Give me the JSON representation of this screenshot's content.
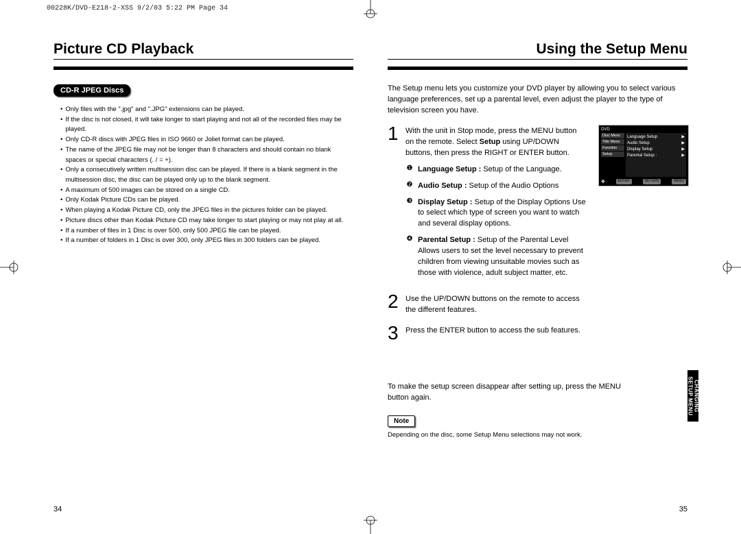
{
  "header": "00228K/DVD-E218-2-XSS  9/2/03 5:22 PM  Page 34",
  "left": {
    "title": "Picture CD Playback",
    "badge": "CD-R JPEG Discs",
    "bullets": [
      "Only files with the \".jpg\" and \".JPG\" extensions can be played.",
      "If the disc is not closed, it will take longer to start playing and not all of the recorded files may be played.",
      "Only CD-R discs with JPEG files in ISO 9660 or Joliet format can be played.",
      "The name of the JPEG file may not be longer than 8 characters and should contain no blank spaces or special characters (. / = +).",
      "Only a consecutively written multisession disc can be played. If there is a blank segment in the multisession disc, the disc can be played only up to the blank segment.",
      "A maximum of 500 images can be stored on a single CD.",
      "Only Kodak Picture CDs can be played.",
      "When playing a Kodak Picture CD, only the JPEG files in the pictures folder can be played.",
      "Picture discs other than Kodak Picture CD may take longer to start playing or may not play at all.",
      "If a number of files in 1 Disc is over 500, only 500 JPEG file can be played.",
      "If a number of folders in 1 Disc is over 300, only JPEG files in 300 folders can be played."
    ],
    "pagenum": "34"
  },
  "right": {
    "title": "Using the Setup Menu",
    "intro": "The Setup menu lets you customize your DVD player by allowing you to select various language preferences, set up a parental level, even adjust the player to the type of television screen you have.",
    "step1_lead": "With the unit in Stop mode, press the MENU button on the remote. Select ",
    "step1_bold": "Setup",
    "step1_tail": " using UP/DOWN buttons, then press the RIGHT or ENTER button.",
    "items": [
      {
        "mark": "❶",
        "label": "Language Setup :",
        "desc": "Setup of the Language."
      },
      {
        "mark": "❷",
        "label": "Audio Setup :",
        "desc": "Setup of the Audio Options"
      },
      {
        "mark": "❸",
        "label": "Display Setup :",
        "desc": "Setup of the Display Options Use to select which type of screen you want to watch and several display options."
      },
      {
        "mark": "❹",
        "label": "Parental Setup :",
        "desc": "Setup of the Parental Level Allows users to set the level necessary to prevent children from viewing unsuitable movies such as those with violence, adult subject matter, etc."
      }
    ],
    "step2": "Use the UP/DOWN buttons on the remote to access the different features.",
    "step3": "Press the ENTER button to access the sub features.",
    "footnote": "To make the setup screen disappear after setting up, press the MENU button again.",
    "note_label": "Note",
    "note_text": "Depending on the disc, some Setup Menu selections may not work.",
    "pagenum": "35",
    "side_tab_l1": "CHANGING",
    "side_tab_l2": "SETUP MENU",
    "osd": {
      "dvd": "DVD",
      "left": [
        "Disc Menu",
        "Title Menu",
        "Function",
        "Setup"
      ],
      "right": [
        "Language Setup",
        "Audio Setup",
        "Display Setup",
        "Parental Setup :"
      ],
      "buttons": [
        "ENTER",
        "RETURN",
        "MENU"
      ]
    }
  }
}
